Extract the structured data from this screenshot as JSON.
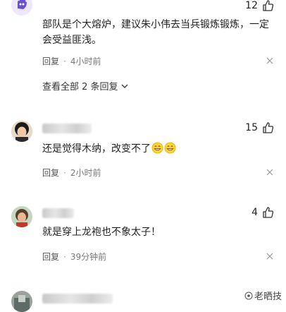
{
  "comments": [
    {
      "like_count": "12",
      "content": "部队是个大熔炉，建议朱小伟去当兵锻炼锻炼，一定会受益匪浅。",
      "reply_label": "回复",
      "time": "4小时前",
      "view_all_label": "查看全部 2 条回复"
    },
    {
      "like_count": "15",
      "content": "还是觉得木纳，改变不了",
      "reply_label": "回复",
      "time": "2小时前"
    },
    {
      "like_count": "4",
      "content": "就是穿上龙袍也不象太子！",
      "reply_label": "回复",
      "time": "39分钟前"
    }
  ],
  "watermark": {
    "text": "老晒技"
  },
  "icons": {
    "like": "thumbs-up-icon",
    "close": "close-icon",
    "expand": "chevron-down-icon",
    "emoji": "grinning-face-icon"
  }
}
